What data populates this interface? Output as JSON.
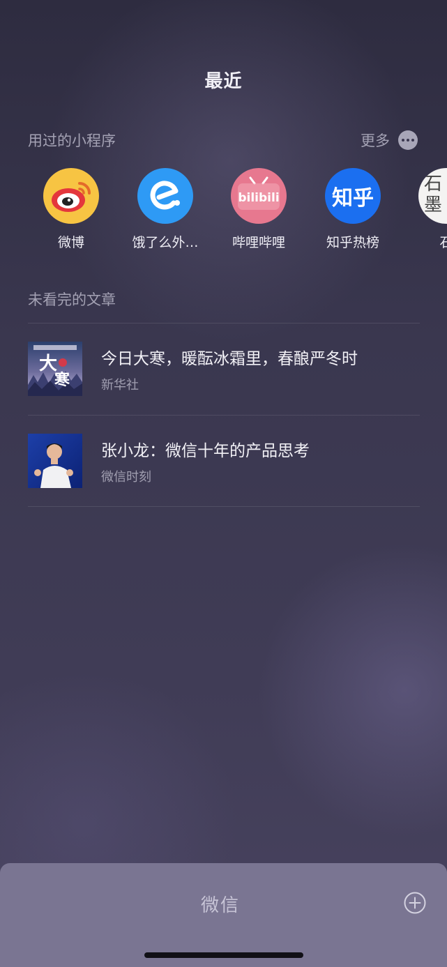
{
  "header": {
    "title": "最近"
  },
  "mini_programs": {
    "section_title": "用过的小程序",
    "more_label": "更多",
    "more_icon": "more-dots-icon",
    "items": [
      {
        "label": "微博",
        "icon": "weibo-icon",
        "color": "#f7c443"
      },
      {
        "label": "饿了么外…",
        "icon": "eleme-icon",
        "color": "#2e9af5"
      },
      {
        "label": "哔哩哔哩",
        "icon": "bilibili-icon",
        "color": "#e7788f",
        "logo_text": "bilibili"
      },
      {
        "label": "知乎热榜",
        "icon": "zhihu-icon",
        "color": "#1b6ff0",
        "logo_text": "知乎"
      },
      {
        "label": "石",
        "icon": "stone-icon",
        "color": "#f4f3f2",
        "logo_text": "石\n墨"
      }
    ]
  },
  "articles": {
    "section_title": "未看完的文章",
    "items": [
      {
        "title": "今日大寒，暖酝冰霜里，春酿严冬时",
        "source": "新华社",
        "thumb": "dahan-thumbnail"
      },
      {
        "title": "张小龙：微信十年的产品思考",
        "source": "微信时刻",
        "thumb": "speaker-thumbnail"
      }
    ]
  },
  "bottom_bar": {
    "title": "微信",
    "add_icon": "plus-circle-icon"
  }
}
